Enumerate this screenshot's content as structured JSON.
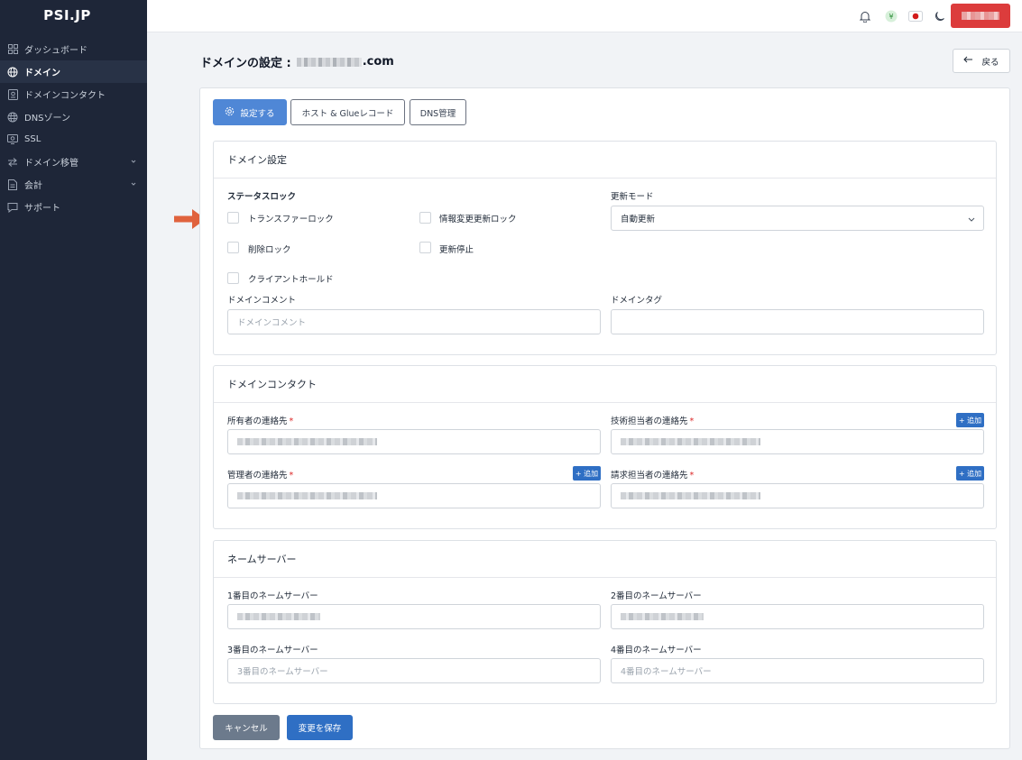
{
  "app": {
    "logo": "PSI.JP"
  },
  "sidebar": {
    "items": [
      {
        "label": "ダッシュボード",
        "icon": "dashboard-icon"
      },
      {
        "label": "ドメイン",
        "icon": "globe-icon",
        "active": true
      },
      {
        "label": "ドメインコンタクト",
        "icon": "contact-card-icon"
      },
      {
        "label": "DNSゾーン",
        "icon": "dns-globe-icon"
      },
      {
        "label": "SSL",
        "icon": "ssl-icon"
      },
      {
        "label": "ドメイン移管",
        "icon": "transfer-icon",
        "chevron": true
      },
      {
        "label": "会計",
        "icon": "document-icon",
        "chevron": true
      },
      {
        "label": "サポート",
        "icon": "chat-icon"
      }
    ]
  },
  "topbar": {
    "icons": [
      "bell-icon",
      "yen-icon",
      "japan-flag-icon",
      "moon-icon"
    ],
    "accent": "#dc3c3c"
  },
  "page": {
    "title_prefix": "ドメインの設定 :",
    "title_suffix": ".com",
    "back_label": "戻る"
  },
  "tabs": {
    "settings": "設定する",
    "hosts": "ホスト & Glueレコード",
    "dns": "DNS管理"
  },
  "domain_settings": {
    "header": "ドメイン設定",
    "status_lock_label": "ステータスロック",
    "checkboxes": {
      "transfer_lock": "トランスファーロック",
      "info_update_lock": "情報変更更新ロック",
      "delete_lock": "削除ロック",
      "update_stop": "更新停止",
      "client_hold": "クライアントホールド"
    },
    "renew_mode_label": "更新モード",
    "renew_mode_value": "自動更新",
    "comment_label": "ドメインコメント",
    "comment_placeholder": "ドメインコメント",
    "tag_label": "ドメインタグ",
    "tag_value": ""
  },
  "contacts": {
    "header": "ドメインコンタクト",
    "owner_label": "所有者の連絡先",
    "tech_label": "技術担当者の連絡先",
    "admin_label": "管理者の連絡先",
    "billing_label": "請求担当者の連絡先",
    "required_mark": "*",
    "add_label": "+ 追加"
  },
  "nameservers": {
    "header": "ネームサーバー",
    "ns1_label": "1番目のネームサーバー",
    "ns2_label": "2番目のネームサーバー",
    "ns3_label": "3番目のネームサーバー",
    "ns3_placeholder": "3番目のネームサーバー",
    "ns4_label": "4番目のネームサーバー",
    "ns4_placeholder": "4番目のネームサーバー"
  },
  "actions": {
    "cancel": "キャンセル",
    "save": "変更を保存"
  },
  "colors": {
    "sidebar_bg": "#1e2638",
    "primary": "#4f87d6",
    "save": "#2f6fc4",
    "cancel": "#6c7a8c",
    "arrow": "#e0623d"
  }
}
